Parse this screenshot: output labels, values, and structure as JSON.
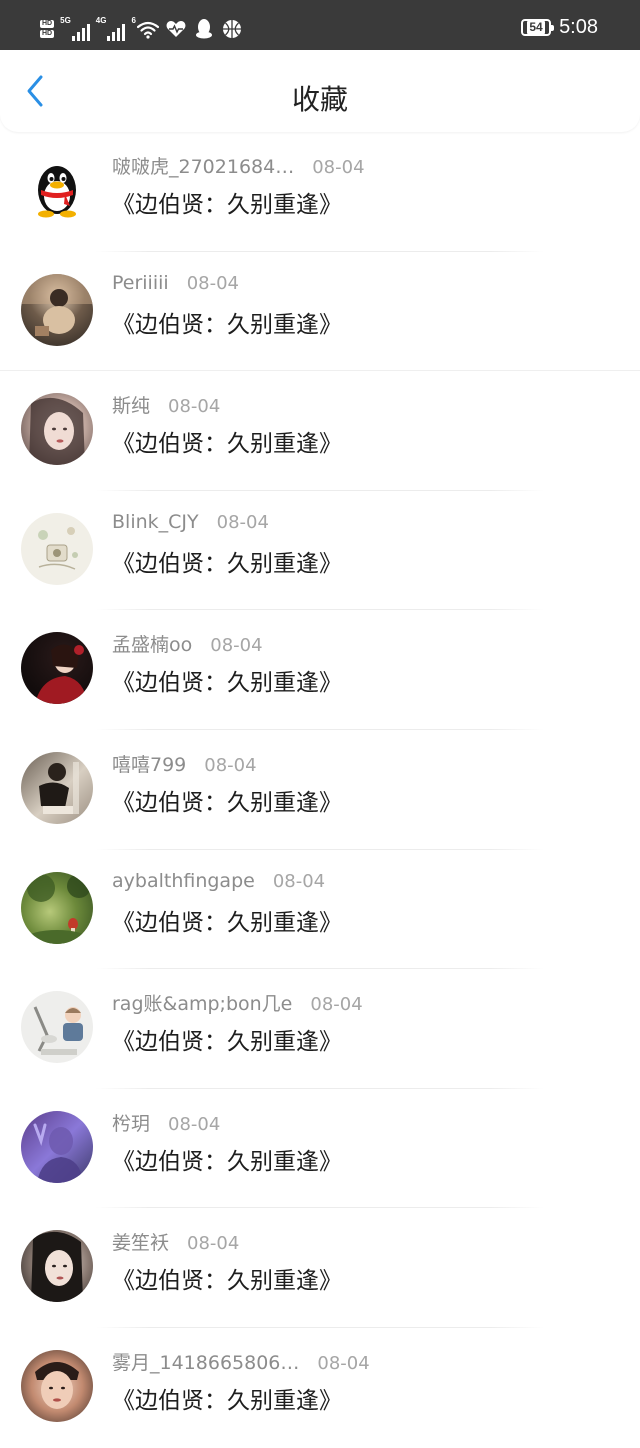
{
  "status_bar": {
    "hd_badges": [
      "HD",
      "HD"
    ],
    "net_labels": [
      "5G",
      "4G"
    ],
    "wifi_label": "6",
    "icons": [
      "signal-icon",
      "signal-icon",
      "wifi-icon",
      "heart-icon",
      "qq-penguin-icon",
      "basketball-icon"
    ],
    "battery": "54",
    "time": "5:08"
  },
  "header": {
    "title": "收藏",
    "back_icon": "chevron-left-icon",
    "accent": "#2a8fe5"
  },
  "items": [
    {
      "user": "啵啵虎_27021684…",
      "date": "08-04",
      "title": "《边伯贤：久别重逢》",
      "avatar": "qq-penguin"
    },
    {
      "user": "Periiiii",
      "date": "08-04",
      "title": "《边伯贤：久别重逢》",
      "avatar": "photo"
    },
    {
      "user": "斯纯",
      "date": "08-04",
      "title": "《边伯贤：久别重逢》",
      "avatar": "photo"
    },
    {
      "user": "Blink_CJY",
      "date": "08-04",
      "title": "《边伯贤：久别重逢》",
      "avatar": "photo"
    },
    {
      "user": "孟盛楠oo",
      "date": "08-04",
      "title": "《边伯贤：久别重逢》",
      "avatar": "photo"
    },
    {
      "user": "嘻嘻799",
      "date": "08-04",
      "title": "《边伯贤：久别重逢》",
      "avatar": "photo"
    },
    {
      "user": "aybalthfingape",
      "date": "08-04",
      "title": "《边伯贤：久别重逢》",
      "avatar": "photo"
    },
    {
      "user": "rag账&amp;bon几e",
      "date": "08-04",
      "title": "《边伯贤：久别重逢》",
      "avatar": "photo"
    },
    {
      "user": "枍玥",
      "date": "08-04",
      "title": "《边伯贤：久别重逢》",
      "avatar": "photo"
    },
    {
      "user": "姜笙袄",
      "date": "08-04",
      "title": "《边伯贤：久别重逢》",
      "avatar": "photo"
    },
    {
      "user": "雾月_1418665806…",
      "date": "08-04",
      "title": "《边伯贤：久别重逢》",
      "avatar": "photo"
    }
  ]
}
